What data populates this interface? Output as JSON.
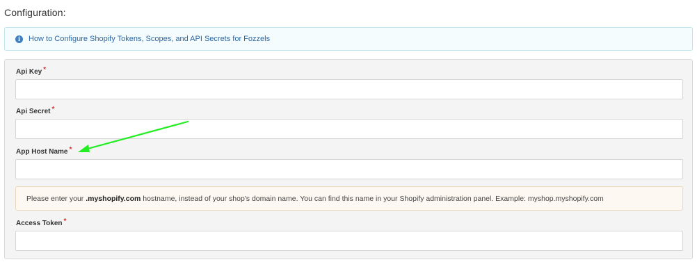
{
  "section": {
    "title": "Configuration:"
  },
  "info": {
    "icon": "info-circle-icon",
    "link_text": "How to Configure Shopify Tokens, Scopes, and API Secrets for Fozzels",
    "accent_color": "#3f7fc1"
  },
  "fields": {
    "api_key": {
      "label": "Api Key",
      "required_mark": "*",
      "value": ""
    },
    "api_secret": {
      "label": "Api Secret",
      "required_mark": "*",
      "value": ""
    },
    "app_host_name": {
      "label": "App Host Name",
      "required_mark": "*",
      "value": ""
    },
    "access_token": {
      "label": "Access Token",
      "required_mark": "*",
      "value": ""
    }
  },
  "hint": {
    "prefix": "Please enter your ",
    "emphasis": ".myshopify.com",
    "suffix": " hostname, instead of your shop's domain name. You can find this name in your Shopify administration panel. Example: myshop.myshopify.com"
  },
  "annotation": {
    "arrow_color": "#22ee22"
  }
}
